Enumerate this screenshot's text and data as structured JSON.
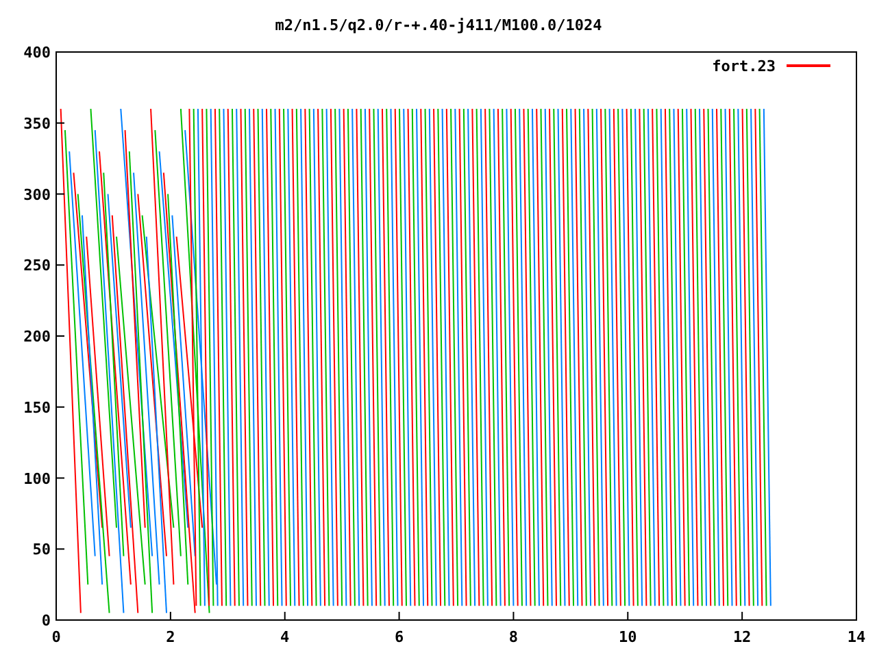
{
  "plot": {
    "title": "m2/n1.5/q2.0/r-+.40-j411/M100.0/1024",
    "y_axis_labels": [
      "400",
      "350",
      "300",
      "250",
      "200",
      "150",
      "100",
      "50",
      "0"
    ],
    "x_axis_labels": [
      "0",
      "2",
      "4",
      "6",
      "8",
      "10",
      "12",
      "14"
    ],
    "legend": [
      {
        "label": "fort.23",
        "color": "#ff0000"
      }
    ]
  }
}
